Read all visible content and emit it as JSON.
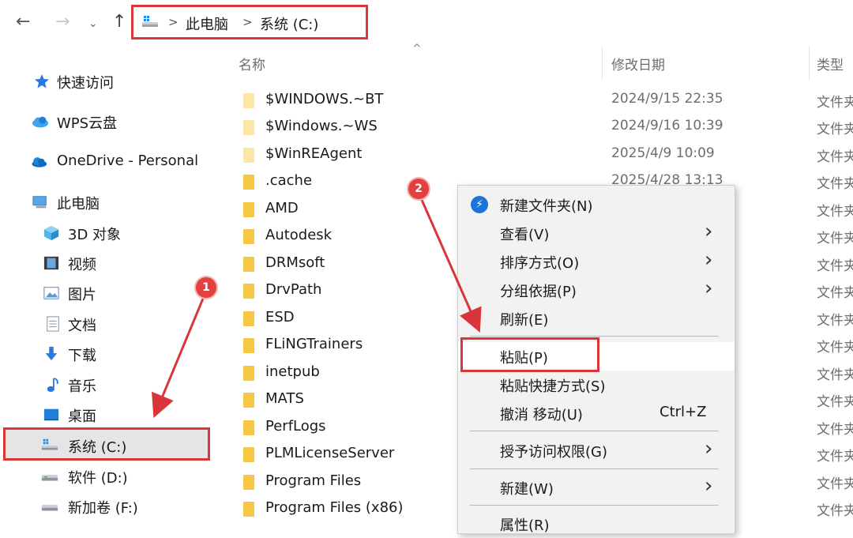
{
  "nav": {
    "back": "←",
    "forward": "→",
    "recent": "⌄",
    "up": "↑",
    "breadcrumb": [
      "此电脑",
      "系统 (C:)"
    ],
    "separator": ">"
  },
  "sidebar": {
    "items": [
      {
        "label": "快速访问",
        "icon": "star-icon"
      },
      {
        "label": "WPS云盘",
        "icon": "cloud-icon"
      },
      {
        "label": "OneDrive - Personal",
        "icon": "onedrive-icon"
      },
      {
        "label": "此电脑",
        "icon": "computer-icon"
      },
      {
        "label": "3D 对象",
        "icon": "3d-objects-icon"
      },
      {
        "label": "视频",
        "icon": "video-icon"
      },
      {
        "label": "图片",
        "icon": "pictures-icon"
      },
      {
        "label": "文档",
        "icon": "documents-icon"
      },
      {
        "label": "下载",
        "icon": "download-icon"
      },
      {
        "label": "音乐",
        "icon": "music-icon"
      },
      {
        "label": "桌面",
        "icon": "desktop-icon"
      },
      {
        "label": "系统 (C:)",
        "icon": "drive-c-icon",
        "selected": true
      },
      {
        "label": "软件 (D:)",
        "icon": "drive-d-icon"
      },
      {
        "label": "新加卷 (F:)",
        "icon": "drive-f-icon"
      }
    ]
  },
  "columns": {
    "name": "名称",
    "modified": "修改日期",
    "type": "类型",
    "sort_indicator": "^"
  },
  "files": [
    {
      "name": "$WINDOWS.~BT",
      "date": "2024/9/15 22:35",
      "type": "文件夹"
    },
    {
      "name": "$Windows.~WS",
      "date": "2024/9/16 10:39",
      "type": "文件夹"
    },
    {
      "name": "$WinREAgent",
      "date": "2025/4/9 10:09",
      "type": "文件夹"
    },
    {
      "name": ".cache",
      "date": "2025/4/28 13:13",
      "type": "文件夹"
    },
    {
      "name": "AMD",
      "date": "",
      "type": "文件夹"
    },
    {
      "name": "Autodesk",
      "date": "",
      "type": "文件夹"
    },
    {
      "name": "DRMsoft",
      "date": "",
      "type": "文件夹"
    },
    {
      "name": "DrvPath",
      "date": "",
      "type": "文件夹"
    },
    {
      "name": "ESD",
      "date": "",
      "type": "文件夹"
    },
    {
      "name": "FLiNGTrainers",
      "date": "",
      "type": "文件夹"
    },
    {
      "name": "inetpub",
      "date": "",
      "type": "文件夹"
    },
    {
      "name": "MATS",
      "date": "",
      "type": "文件夹"
    },
    {
      "name": "PerfLogs",
      "date": "",
      "type": "文件夹"
    },
    {
      "name": "PLMLicenseServer",
      "date": "",
      "type": "文件夹"
    },
    {
      "name": "Program Files",
      "date": "",
      "type": "文件夹"
    },
    {
      "name": "Program Files (x86)",
      "date": "",
      "type": "文件夹"
    }
  ],
  "context_menu": {
    "new_folder": "新建文件夹(N)",
    "view": "查看(V)",
    "sort_by": "排序方式(O)",
    "group_by": "分组依据(P)",
    "refresh": "刷新(E)",
    "paste": "粘贴(P)",
    "paste_shortcut": "粘贴快捷方式(S)",
    "undo_move": "撤消 移动(U)",
    "undo_shortcut": "Ctrl+Z",
    "grant_access": "授予访问权限(G)",
    "new": "新建(W)",
    "properties": "属性(R)",
    "submenu_arrow": "›"
  },
  "annotations": {
    "step1": "1",
    "step2": "2",
    "accent": "#d9353b"
  }
}
